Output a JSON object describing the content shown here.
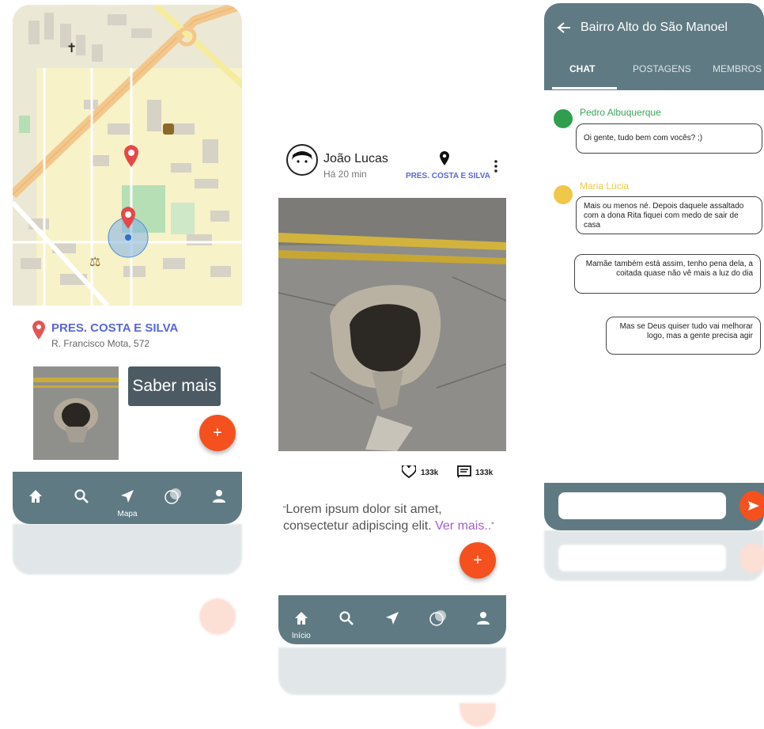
{
  "map_screen": {
    "location_title": "PRES. COSTA E SILVA",
    "location_address": "R. Francisco Mota, 572",
    "saber_mais": "Saber mais",
    "fab_label": "+",
    "nav": {
      "items": [
        {
          "icon": "home-icon"
        },
        {
          "icon": "search-icon"
        },
        {
          "icon": "navigation-arrow-icon",
          "label": "Mapa"
        },
        {
          "icon": "circles-icon"
        },
        {
          "icon": "user-icon"
        }
      ]
    }
  },
  "post_screen": {
    "user_name": "João Lucas",
    "time_ago": "Há 20 min",
    "location": "PRES. COSTA E SILVA",
    "likes": "133k",
    "comments": "133k",
    "quote_open": "“",
    "text": "Lorem ipsum dolor sit amet, consectetur adipiscing elit.",
    "see_more": "Ver mais..",
    "quote_close": "”",
    "fab_label": "+",
    "nav": {
      "items": [
        {
          "icon": "home-icon",
          "label": "Início"
        },
        {
          "icon": "search-icon"
        },
        {
          "icon": "navigation-arrow-icon"
        },
        {
          "icon": "circles-icon"
        },
        {
          "icon": "user-icon"
        }
      ]
    }
  },
  "chat_screen": {
    "title": "Bairro Alto do São Manoel",
    "tabs": [
      "CHAT",
      "POSTAGENS",
      "MEMBROS"
    ],
    "active_tab": "CHAT",
    "messages": [
      {
        "sender": "Pedro Albuquerque",
        "sender_color": "#3aa55a",
        "text": "Oi gente, tudo bem com vocês? ;)"
      },
      {
        "sender": "Maria Lúcia",
        "sender_color": "#f0c94a",
        "text": "Mais ou menos né. Depois daquele assaltado com a dona Rita fiquei com medo de sair de casa"
      },
      {
        "sender": "",
        "text": "Mamãe também está assim, tenho pena dela, a coitada quase não vê mais a luz do dia"
      },
      {
        "sender": "",
        "text": "Mas se Deus quiser tudo vai melhorar logo, mas a gente precisa agir"
      }
    ],
    "input_placeholder": "",
    "colors": {
      "header": "#5f7a83",
      "send": "#f4511e"
    }
  }
}
